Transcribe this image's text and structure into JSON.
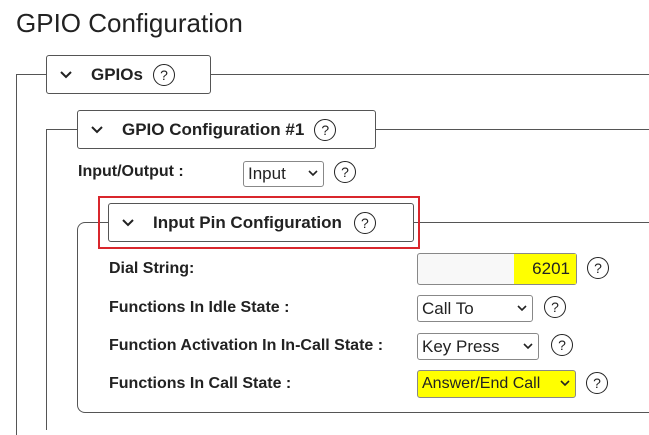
{
  "page": {
    "title": "GPIO Configuration"
  },
  "gpios_section": {
    "label": "GPIOs",
    "help": "?"
  },
  "gpio_config_section": {
    "label": "GPIO Configuration #1",
    "help": "?"
  },
  "input_output": {
    "label": "Input/Output :",
    "value": "Input",
    "help": "?"
  },
  "input_pin_section": {
    "label": "Input Pin Configuration",
    "help": "?"
  },
  "dial_string": {
    "label": "Dial String:",
    "value": "6201",
    "help": "?"
  },
  "idle_functions": {
    "label": "Functions In Idle State :",
    "value": "Call To",
    "help": "?"
  },
  "in_call_activation": {
    "label": "Function Activation In In-Call State :",
    "value": "Key Press",
    "help": "?"
  },
  "call_functions": {
    "label": "Functions In Call State :",
    "value": "Answer/End Call",
    "help": "?"
  },
  "colors": {
    "highlight": "#ffff00",
    "callout": "#d9262c",
    "border": "#555555"
  },
  "icons": {
    "collapse": "chevron-down-icon",
    "help": "help-circle-icon",
    "dropdown": "caret-down-icon"
  }
}
